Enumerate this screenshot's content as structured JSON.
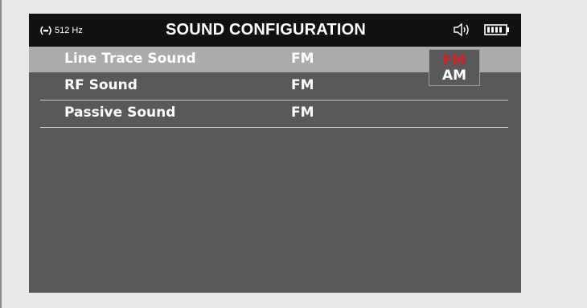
{
  "header": {
    "frequency": "512 Hz",
    "title": "SOUND CONFIGURATION",
    "icons": [
      "signal-icon",
      "speaker-icon",
      "battery-icon"
    ]
  },
  "settings": [
    {
      "label": "Line Trace Sound",
      "value": "FM",
      "selected": true
    },
    {
      "label": "RF Sound",
      "value": "FM",
      "selected": false
    },
    {
      "label": "Passive Sound",
      "value": "FM",
      "selected": false
    }
  ],
  "dropdown": {
    "options": [
      "FM",
      "AM"
    ],
    "highlighted": "FM"
  },
  "colors": {
    "highlight_text": "#d32027",
    "selected_row": "#ababab",
    "screen_bg": "#595959",
    "header_bg": "#111111"
  }
}
